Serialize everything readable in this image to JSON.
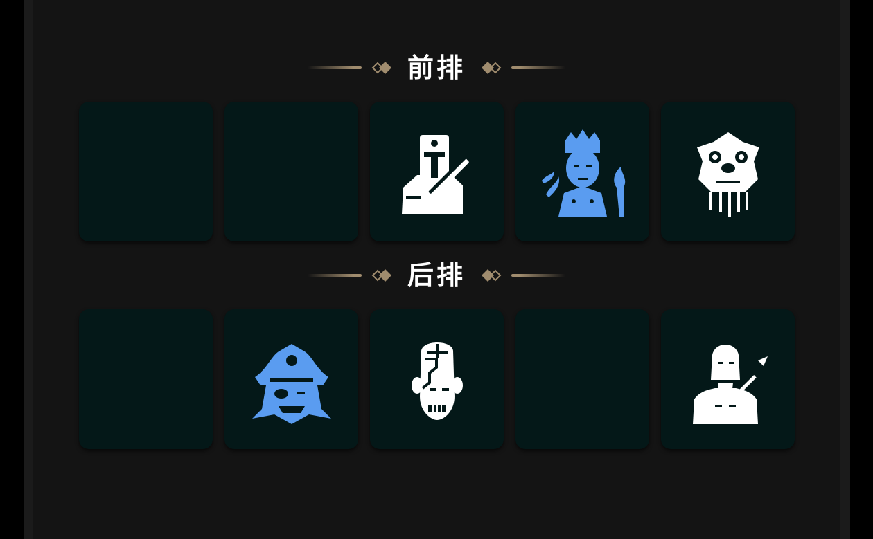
{
  "front_row": {
    "title": "前排",
    "slots": [
      {
        "occupied": false
      },
      {
        "occupied": false
      },
      {
        "occupied": true,
        "icon": "knight-icon",
        "color": "#ffffff"
      },
      {
        "occupied": true,
        "icon": "goddess-icon",
        "color": "#5a9cf0"
      },
      {
        "occupied": true,
        "icon": "lion-mask-icon",
        "color": "#ffffff"
      }
    ]
  },
  "back_row": {
    "title": "后排",
    "slots": [
      {
        "occupied": false
      },
      {
        "occupied": true,
        "icon": "pirate-captain-icon",
        "color": "#5a9cf0"
      },
      {
        "occupied": true,
        "icon": "cyborg-head-icon",
        "color": "#ffffff"
      },
      {
        "occupied": false
      },
      {
        "occupied": true,
        "icon": "zeus-icon",
        "color": "#ffffff"
      }
    ]
  },
  "colors": {
    "panel": "#141414",
    "slot": "#041818",
    "ornament": "#a08c6e",
    "rare_icon": "#5a9cf0",
    "common_icon": "#ffffff"
  }
}
